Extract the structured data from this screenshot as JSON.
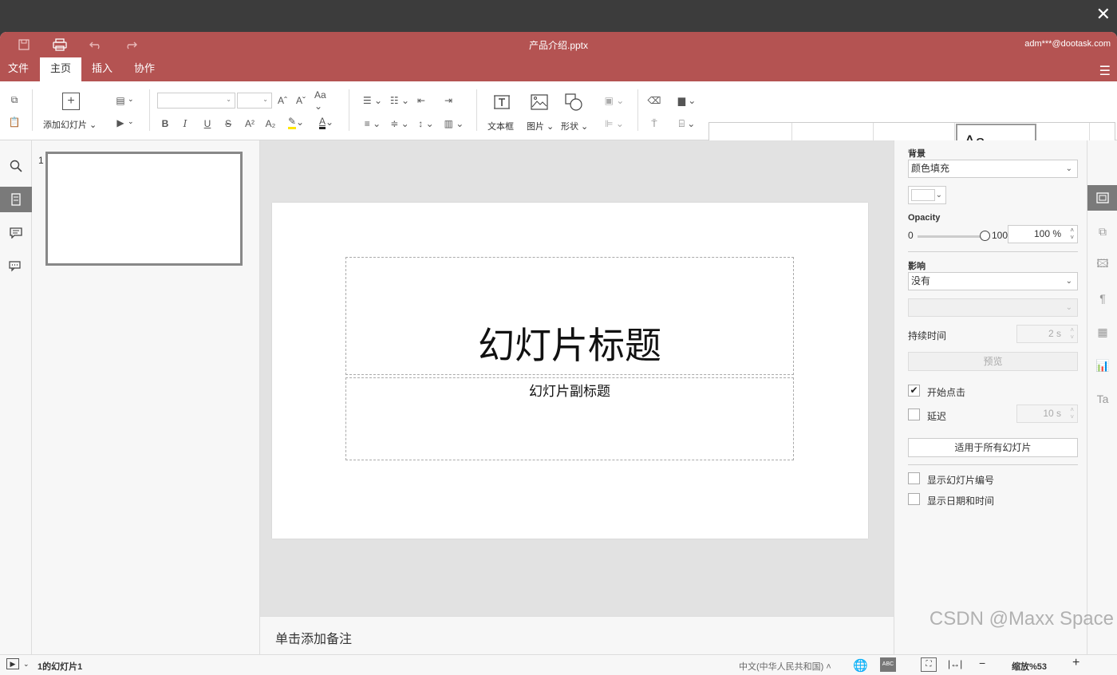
{
  "overlay": {
    "close_glyph": "✕"
  },
  "titlebar": {
    "doc_title": "产品介绍.pptx",
    "user_email": "adm***@dootask.com"
  },
  "menu": {
    "tabs": [
      "文件",
      "主页",
      "插入",
      "协作"
    ],
    "active": "主页"
  },
  "toolbar": {
    "add_slide_label": "添加幻灯片",
    "textbox_label": "文本框",
    "image_label": "图片",
    "shape_label": "形状",
    "theme_sample": "Aa"
  },
  "thumbnails": [
    {
      "number": "1"
    }
  ],
  "slide": {
    "title": "幻灯片标题",
    "subtitle": "幻灯片副标题"
  },
  "notes_placeholder": "单击添加备注",
  "right_panel": {
    "background_label": "背景",
    "fill_value": "颜色填充",
    "opacity_label": "Opacity",
    "opacity_min": "0",
    "opacity_max": "100",
    "opacity_value": "100 %",
    "opacity_level": 1.0,
    "effect_label": "影响",
    "effect_value": "没有",
    "duration_label": "持续时间",
    "duration_value": "2 s",
    "preview_label": "预览",
    "start_on_click_label": "开始点击",
    "start_on_click_checked": true,
    "delay_label": "延迟",
    "delay_checked": false,
    "delay_value": "10 s",
    "apply_all_label": "适用于所有幻灯片",
    "show_slide_number_label": "显示幻灯片编号",
    "show_date_time_label": "显示日期和时间"
  },
  "statusbar": {
    "slide_counter": "1的幻灯片1",
    "language": "中文(中华人民共和国)",
    "zoom": "缩放%53"
  },
  "watermark": "CSDN @Maxx Space",
  "colors": {
    "brand": "#b45352",
    "theme_bars": [
      "#4472c4",
      "#ed7d31",
      "#a5a5a5",
      "#ffc000",
      "#5b9bd5",
      "#70ad47"
    ]
  }
}
